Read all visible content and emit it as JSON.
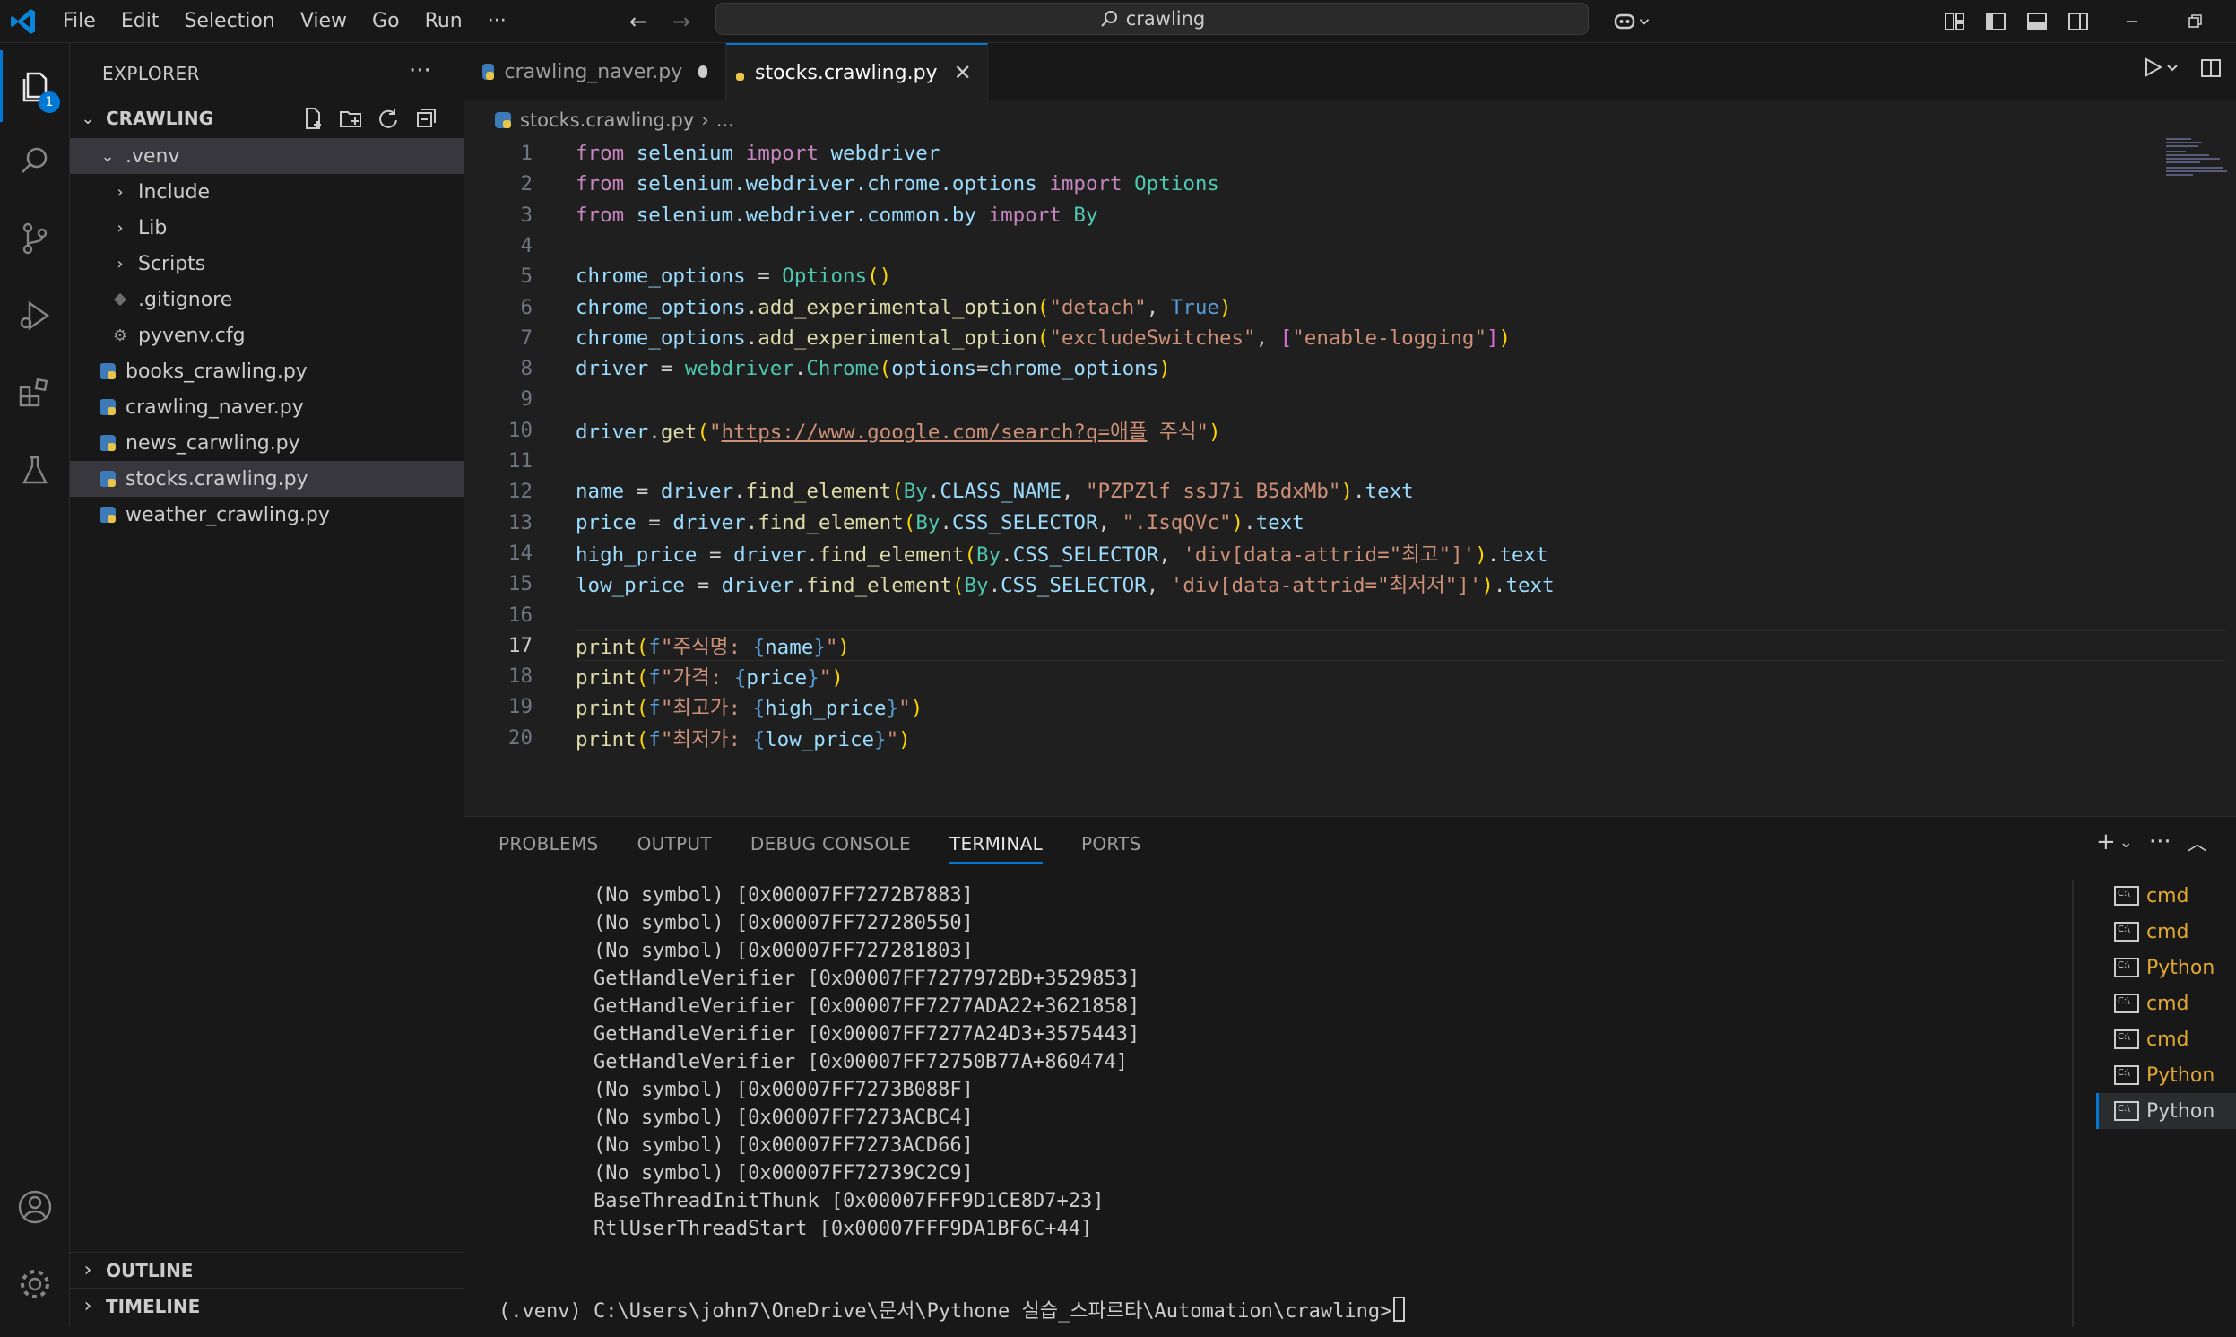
{
  "menu": [
    "File",
    "Edit",
    "Selection",
    "View",
    "Go",
    "Run",
    "···"
  ],
  "search": {
    "text": "crawling"
  },
  "activity_badge": "1",
  "explorer": {
    "title": "EXPLORER",
    "more": "···",
    "folder": "CRAWLING",
    "tree": [
      {
        "label": ".venv",
        "kind": "folder-open"
      },
      {
        "label": "Include",
        "kind": "folder"
      },
      {
        "label": "Lib",
        "kind": "folder"
      },
      {
        "label": "Scripts",
        "kind": "folder"
      },
      {
        "label": ".gitignore",
        "kind": "git"
      },
      {
        "label": "pyvenv.cfg",
        "kind": "gear"
      },
      {
        "label": "books_crawling.py",
        "kind": "python"
      },
      {
        "label": "crawling_naver.py",
        "kind": "python"
      },
      {
        "label": "news_carwling.py",
        "kind": "python"
      },
      {
        "label": "stocks.crawling.py",
        "kind": "python",
        "selected": true
      },
      {
        "label": "weather_crawling.py",
        "kind": "python"
      }
    ],
    "outline": "OUTLINE",
    "timeline": "TIMELINE"
  },
  "tabs": [
    {
      "label": "crawling_naver.py",
      "state": "modified"
    },
    {
      "label": "stocks.crawling.py",
      "state": "active"
    }
  ],
  "breadcrumb": {
    "file": "stocks.crawling.py",
    "rest": "..."
  },
  "code": {
    "current_line": 17,
    "lines": [
      [
        [
          "kw",
          "from"
        ],
        [
          "pl",
          " "
        ],
        [
          "var",
          "selenium"
        ],
        [
          "pl",
          " "
        ],
        [
          "kw",
          "import"
        ],
        [
          "pl",
          " "
        ],
        [
          "var",
          "webdriver"
        ]
      ],
      [
        [
          "kw",
          "from"
        ],
        [
          "pl",
          " "
        ],
        [
          "var",
          "selenium.webdriver.chrome.options"
        ],
        [
          "pl",
          " "
        ],
        [
          "kw",
          "import"
        ],
        [
          "pl",
          " "
        ],
        [
          "cls",
          "Options"
        ]
      ],
      [
        [
          "kw",
          "from"
        ],
        [
          "pl",
          " "
        ],
        [
          "var",
          "selenium.webdriver.common.by"
        ],
        [
          "pl",
          " "
        ],
        [
          "kw",
          "import"
        ],
        [
          "pl",
          " "
        ],
        [
          "cls",
          "By"
        ]
      ],
      [],
      [
        [
          "var",
          "chrome_options"
        ],
        [
          "pl",
          " = "
        ],
        [
          "cls",
          "Options"
        ],
        [
          "b1",
          "()"
        ]
      ],
      [
        [
          "var",
          "chrome_options"
        ],
        [
          "pl",
          "."
        ],
        [
          "fn",
          "add_experimental_option"
        ],
        [
          "b1",
          "("
        ],
        [
          "str",
          "\"detach\""
        ],
        [
          "pl",
          ", "
        ],
        [
          "const",
          "True"
        ],
        [
          "b1",
          ")"
        ]
      ],
      [
        [
          "var",
          "chrome_options"
        ],
        [
          "pl",
          "."
        ],
        [
          "fn",
          "add_experimental_option"
        ],
        [
          "b1",
          "("
        ],
        [
          "str",
          "\"excludeSwitches\""
        ],
        [
          "pl",
          ", "
        ],
        [
          "b2",
          "["
        ],
        [
          "str",
          "\"enable-logging\""
        ],
        [
          "b2",
          "]"
        ],
        [
          "b1",
          ")"
        ]
      ],
      [
        [
          "var",
          "driver"
        ],
        [
          "pl",
          " = "
        ],
        [
          "cls",
          "webdriver"
        ],
        [
          "pl",
          "."
        ],
        [
          "cls",
          "Chrome"
        ],
        [
          "b1",
          "("
        ],
        [
          "var",
          "options"
        ],
        [
          "pl",
          "="
        ],
        [
          "var",
          "chrome_options"
        ],
        [
          "b1",
          ")"
        ]
      ],
      [],
      [
        [
          "var",
          "driver"
        ],
        [
          "pl",
          "."
        ],
        [
          "fn",
          "get"
        ],
        [
          "b1",
          "("
        ],
        [
          "str",
          "\""
        ],
        [
          "url",
          "https://www.google.com/search?q=애플"
        ],
        [
          "str",
          " 주식\""
        ],
        [
          "b1",
          ")"
        ]
      ],
      [],
      [
        [
          "var",
          "name"
        ],
        [
          "pl",
          " = "
        ],
        [
          "var",
          "driver"
        ],
        [
          "pl",
          "."
        ],
        [
          "fn",
          "find_element"
        ],
        [
          "b1",
          "("
        ],
        [
          "cls",
          "By"
        ],
        [
          "pl",
          "."
        ],
        [
          "var",
          "CLASS_NAME"
        ],
        [
          "pl",
          ", "
        ],
        [
          "str",
          "\"PZPZlf ssJ7i B5dxMb\""
        ],
        [
          "b1",
          ")"
        ],
        [
          "pl",
          "."
        ],
        [
          "var",
          "text"
        ]
      ],
      [
        [
          "var",
          "price"
        ],
        [
          "pl",
          " = "
        ],
        [
          "var",
          "driver"
        ],
        [
          "pl",
          "."
        ],
        [
          "fn",
          "find_element"
        ],
        [
          "b1",
          "("
        ],
        [
          "cls",
          "By"
        ],
        [
          "pl",
          "."
        ],
        [
          "var",
          "CSS_SELECTOR"
        ],
        [
          "pl",
          ", "
        ],
        [
          "str",
          "\".IsqQVc\""
        ],
        [
          "b1",
          ")"
        ],
        [
          "pl",
          "."
        ],
        [
          "var",
          "text"
        ]
      ],
      [
        [
          "var",
          "high_price"
        ],
        [
          "pl",
          " = "
        ],
        [
          "var",
          "driver"
        ],
        [
          "pl",
          "."
        ],
        [
          "fn",
          "find_element"
        ],
        [
          "b1",
          "("
        ],
        [
          "cls",
          "By"
        ],
        [
          "pl",
          "."
        ],
        [
          "var",
          "CSS_SELECTOR"
        ],
        [
          "pl",
          ", "
        ],
        [
          "str",
          "'div[data-attrid=\"최고\"]'"
        ],
        [
          "b1",
          ")"
        ],
        [
          "pl",
          "."
        ],
        [
          "var",
          "text"
        ]
      ],
      [
        [
          "var",
          "low_price"
        ],
        [
          "pl",
          " = "
        ],
        [
          "var",
          "driver"
        ],
        [
          "pl",
          "."
        ],
        [
          "fn",
          "find_element"
        ],
        [
          "b1",
          "("
        ],
        [
          "cls",
          "By"
        ],
        [
          "pl",
          "."
        ],
        [
          "var",
          "CSS_SELECTOR"
        ],
        [
          "pl",
          ", "
        ],
        [
          "str",
          "'div[data-attrid=\"최저저\"]'"
        ],
        [
          "b1",
          ")"
        ],
        [
          "pl",
          "."
        ],
        [
          "var",
          "text"
        ]
      ],
      [],
      [
        [
          "fn",
          "print"
        ],
        [
          "b1",
          "("
        ],
        [
          "const",
          "f"
        ],
        [
          "str",
          "\"주식명: "
        ],
        [
          "const",
          "{"
        ],
        [
          "var",
          "name"
        ],
        [
          "const",
          "}"
        ],
        [
          "str",
          "\""
        ],
        [
          "b1",
          ")"
        ]
      ],
      [
        [
          "fn",
          "print"
        ],
        [
          "b1",
          "("
        ],
        [
          "const",
          "f"
        ],
        [
          "str",
          "\"가격: "
        ],
        [
          "const",
          "{"
        ],
        [
          "var",
          "price"
        ],
        [
          "const",
          "}"
        ],
        [
          "str",
          "\""
        ],
        [
          "b1",
          ")"
        ]
      ],
      [
        [
          "fn",
          "print"
        ],
        [
          "b1",
          "("
        ],
        [
          "const",
          "f"
        ],
        [
          "str",
          "\"최고가: "
        ],
        [
          "const",
          "{"
        ],
        [
          "var",
          "high_price"
        ],
        [
          "const",
          "}"
        ],
        [
          "str",
          "\""
        ],
        [
          "b1",
          ")"
        ]
      ],
      [
        [
          "fn",
          "print"
        ],
        [
          "b1",
          "("
        ],
        [
          "const",
          "f"
        ],
        [
          "str",
          "\"최저가: "
        ],
        [
          "const",
          "{"
        ],
        [
          "var",
          "low_price"
        ],
        [
          "const",
          "}"
        ],
        [
          "str",
          "\""
        ],
        [
          "b1",
          ")"
        ]
      ]
    ]
  },
  "panel": {
    "tabs": [
      "PROBLEMS",
      "OUTPUT",
      "DEBUG CONSOLE",
      "TERMINAL",
      "PORTS"
    ],
    "active_tab": "TERMINAL",
    "terminal_lines": [
      "(No symbol) [0x00007FF7272B7883]",
      "(No symbol) [0x00007FF727280550]",
      "(No symbol) [0x00007FF727281803]",
      "GetHandleVerifier [0x00007FF7277972BD+3529853]",
      "GetHandleVerifier [0x00007FF7277ADA22+3621858]",
      "GetHandleVerifier [0x00007FF7277A24D3+3575443]",
      "GetHandleVerifier [0x00007FF72750B77A+860474]",
      "(No symbol) [0x00007FF7273B088F]",
      "(No symbol) [0x00007FF7273ACBC4]",
      "(No symbol) [0x00007FF7273ACD66]",
      "(No symbol) [0x00007FF72739C2C9]",
      "BaseThreadInitThunk [0x00007FFF9D1CE8D7+23]",
      "RtlUserThreadStart [0x00007FFF9DA1BF6C+44]"
    ],
    "prompt": "(.venv) C:\\Users\\john7\\OneDrive\\문서\\Pythone 실습_스파르타\\Automation\\crawling>",
    "terminals": [
      {
        "label": "cmd"
      },
      {
        "label": "cmd"
      },
      {
        "label": "Python"
      },
      {
        "label": "cmd"
      },
      {
        "label": "cmd"
      },
      {
        "label": "Python"
      },
      {
        "label": "Python",
        "selected": true
      }
    ]
  },
  "colors": {
    "accent": "#0078d4",
    "terminal_list": "#e2a833"
  }
}
